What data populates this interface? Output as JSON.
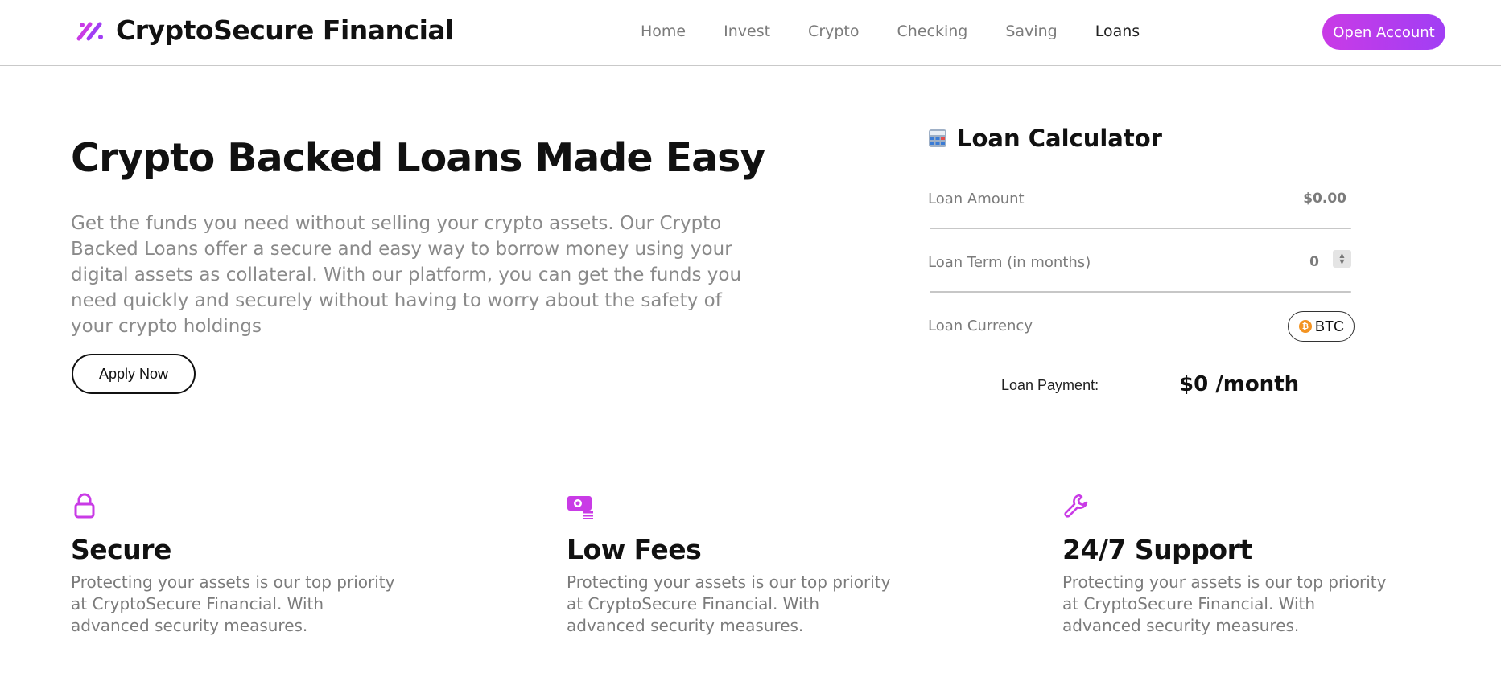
{
  "brand": {
    "name": "CryptoSecure Financial"
  },
  "nav": {
    "items": [
      "Home",
      "Invest",
      "Crypto",
      "Checking",
      "Saving",
      "Loans"
    ],
    "active": "Loans"
  },
  "header": {
    "cta_label": "Open Account"
  },
  "hero": {
    "title": "Crypto Backed Loans Made Easy",
    "description": "Get the funds you need without selling your crypto assets. Our Crypto Backed Loans offer a secure and easy way to borrow money using your digital assets as collateral. With our platform, you can get the funds you need quickly and securely without having to worry about the safety of your crypto holdings",
    "apply_label": "Apply Now"
  },
  "calculator": {
    "title": "Loan Calculator",
    "amount_label": "Loan Amount",
    "amount_value": "$0.00",
    "term_label": "Loan Term (in months)",
    "term_value": "0",
    "currency_label": "Loan Currency",
    "currency_value": "BTC",
    "payment_label": "Loan Payment:",
    "payment_value": "$0 /month"
  },
  "features": [
    {
      "icon": "lock-icon",
      "title": "Secure",
      "text": "Protecting your assets is our top priority at CryptoSecure Financial. With advanced security measures."
    },
    {
      "icon": "money-icon",
      "title": "Low Fees",
      "text": "Protecting your assets is our top priority at CryptoSecure Financial. With advanced security measures."
    },
    {
      "icon": "wrench-icon",
      "title": "24/7 Support",
      "text": "Protecting your assets is our top priority at CryptoSecure Financial. With advanced security measures."
    }
  ],
  "colors": {
    "accent": "#c93be6",
    "accent_end": "#a13ef4",
    "muted_text": "#8a8a8a",
    "btc": "#f39321"
  }
}
